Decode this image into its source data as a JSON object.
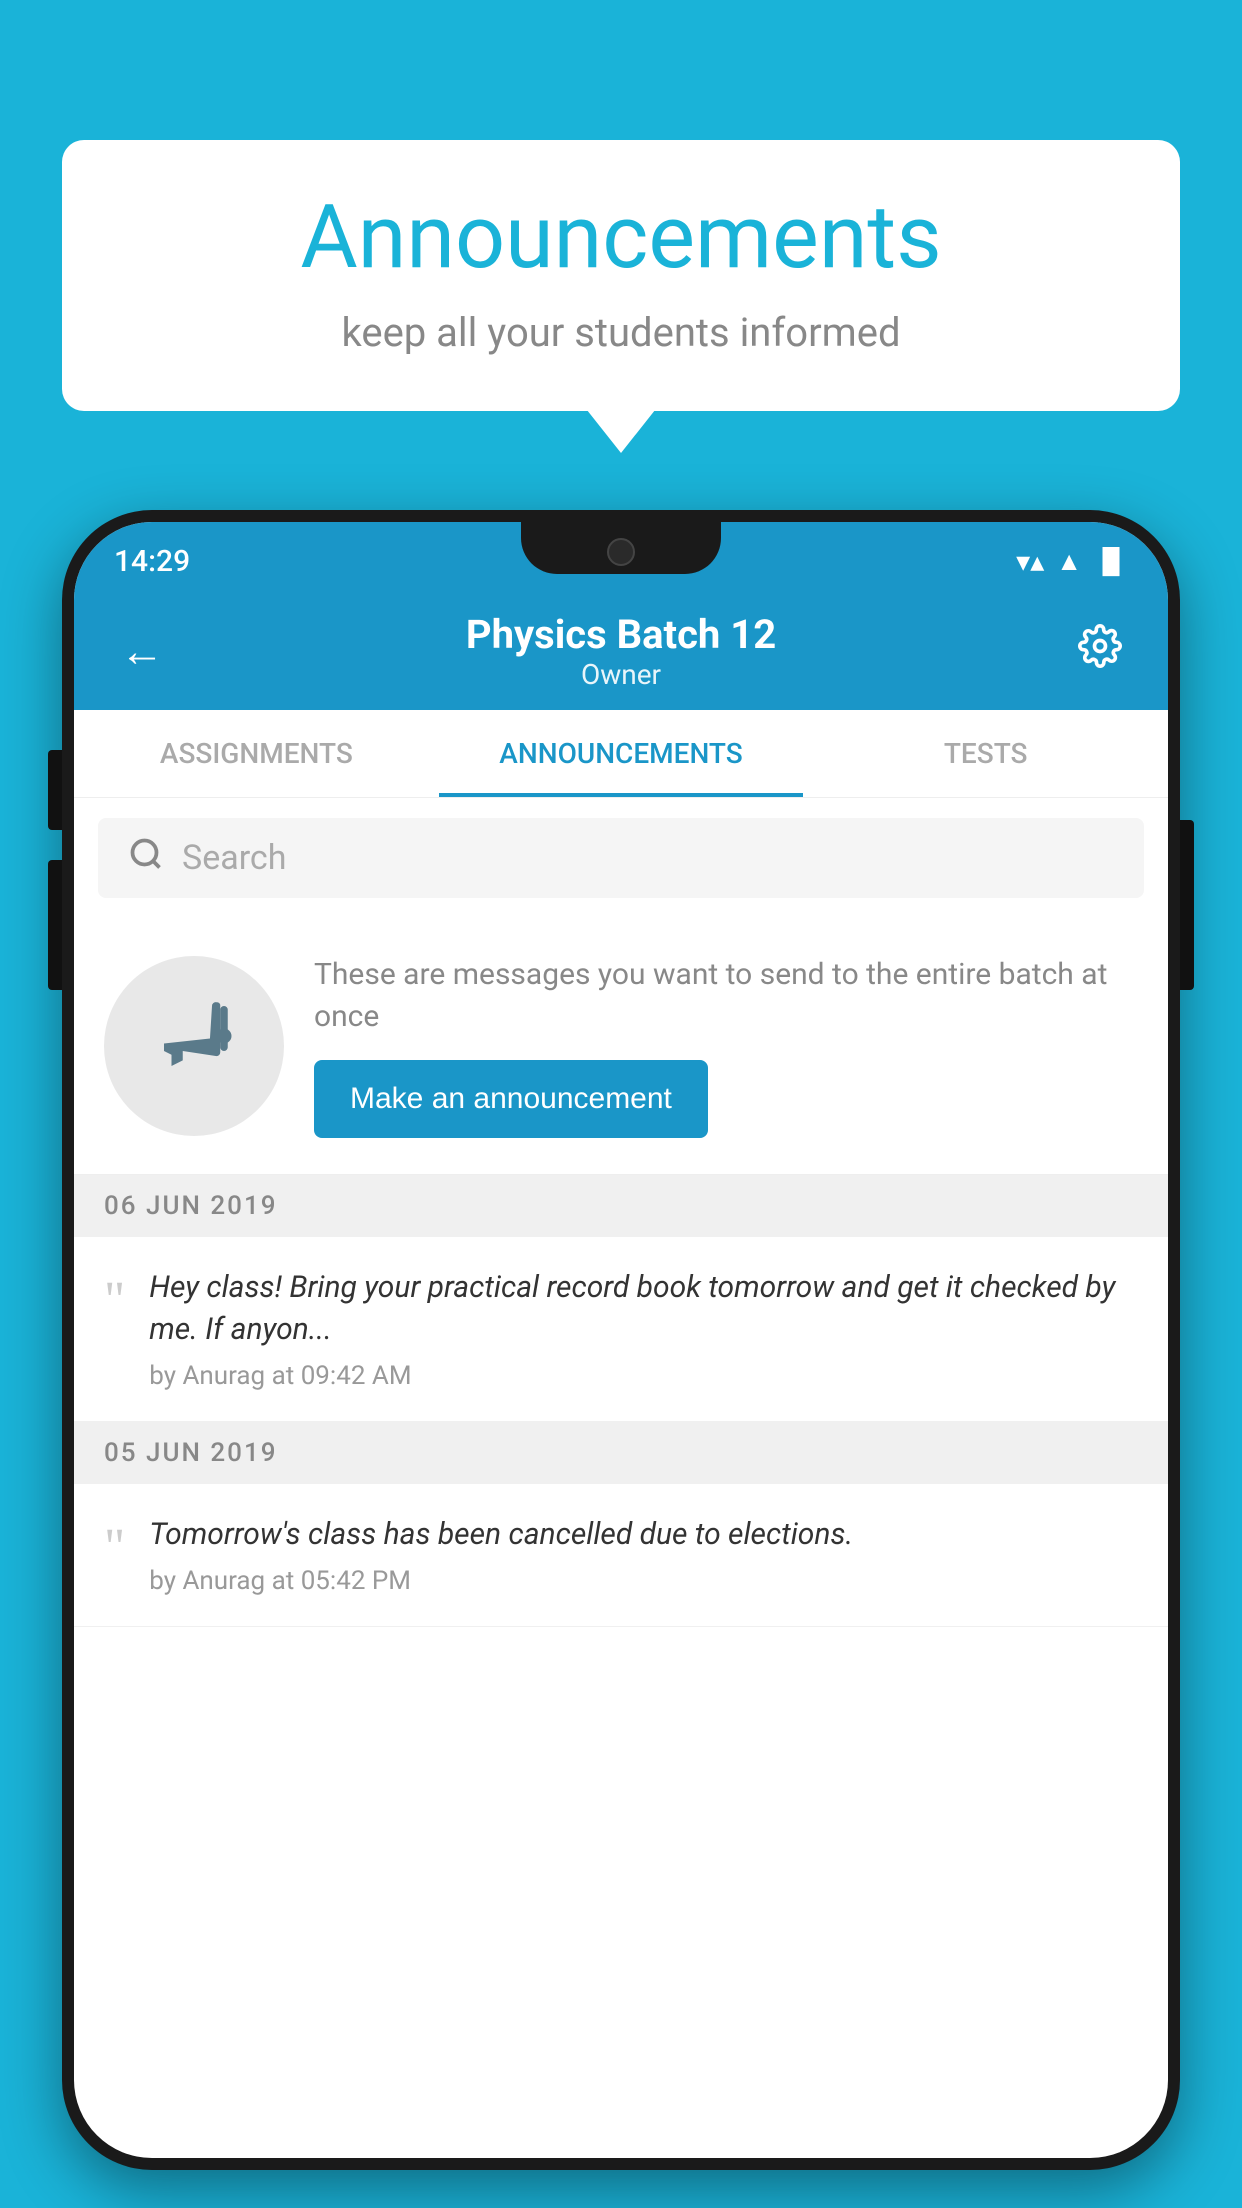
{
  "bubble": {
    "title": "Announcements",
    "subtitle": "keep all your students informed"
  },
  "status_bar": {
    "time": "14:29",
    "wifi": "▼",
    "signal": "▲",
    "battery": "▐"
  },
  "app_bar": {
    "title": "Physics Batch 12",
    "subtitle": "Owner",
    "back_label": "←",
    "settings_label": "⚙"
  },
  "tabs": [
    {
      "label": "ASSIGNMENTS",
      "active": false
    },
    {
      "label": "ANNOUNCEMENTS",
      "active": true
    },
    {
      "label": "TESTS",
      "active": false
    }
  ],
  "search": {
    "placeholder": "Search"
  },
  "promo": {
    "description": "These are messages you want to send to the entire batch at once",
    "button_label": "Make an announcement"
  },
  "date_groups": [
    {
      "date": "06  JUN  2019",
      "items": [
        {
          "text": "Hey class! Bring your practical record book tomorrow and get it checked by me. If anyon...",
          "author": "by Anurag at 09:42 AM"
        }
      ]
    },
    {
      "date": "05  JUN  2019",
      "items": [
        {
          "text": "Tomorrow's class has been cancelled due to elections.",
          "author": "by Anurag at 05:42 PM"
        }
      ]
    }
  ],
  "colors": {
    "primary": "#1a96c8",
    "background": "#1ab3d8"
  }
}
